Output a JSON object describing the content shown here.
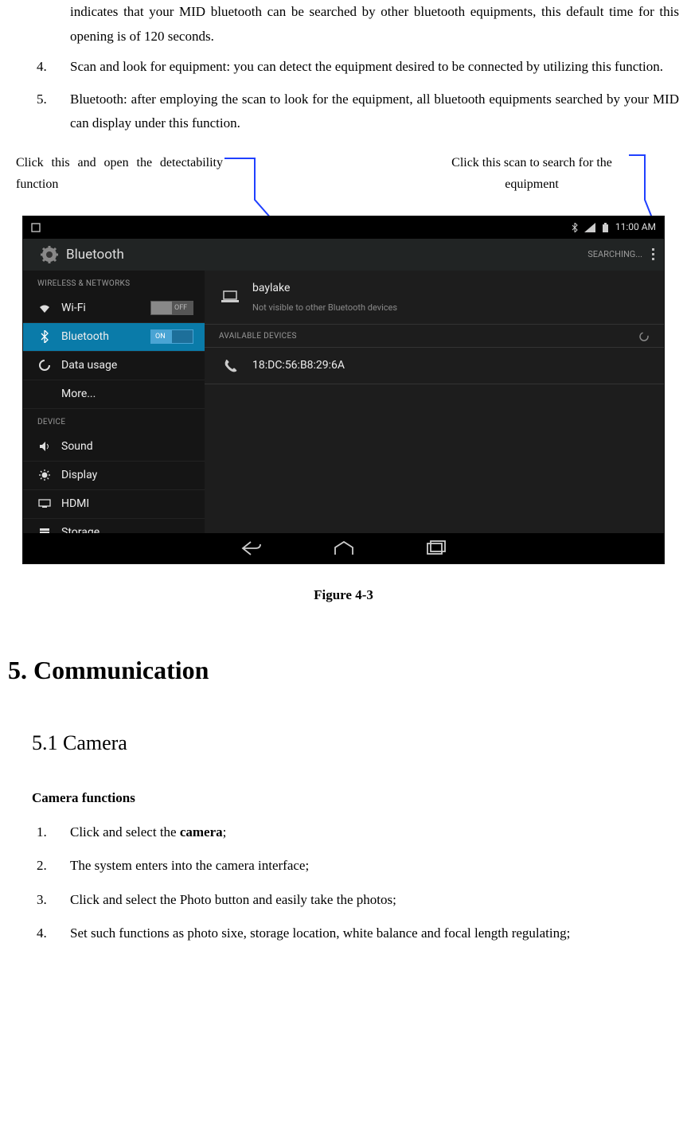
{
  "doc": {
    "continued_text": "indicates that your MID bluetooth can be searched by other bluetooth equipments, this default time for this opening is of 120 seconds.",
    "item4_num": "4.",
    "item4": "Scan and look for equipment: you can detect the equipment desired to be connected by utilizing this function.",
    "item5_num": "5.",
    "item5": "Bluetooth: after employing the scan to look for the equipment, all bluetooth equipments searched by your MID can display under this function.",
    "callout_left": "Click this and open the detectability function",
    "callout_right": "Click this scan to search for the equipment",
    "figure_caption": "Figure 4-3",
    "section5": "5. Communication",
    "subsection51": "5.1 Camera",
    "camera_functions_head": "Camera functions",
    "cam1_num": "1.",
    "cam1_pre": "Click and select the ",
    "cam1_bold": "camera",
    "cam1_post": ";",
    "cam2_num": "2.",
    "cam2": "The system enters into the camera interface;",
    "cam3_num": "3.",
    "cam3": "Click and select the Photo button and easily take the photos;",
    "cam4_num": "4.",
    "cam4": "Set such functions as photo sixe, storage location, white balance and focal length regulating;"
  },
  "screenshot": {
    "status_time": "11:00 AM",
    "app_title": "Bluetooth",
    "searching_label": "SEARCHING...",
    "section_wireless": "WIRELESS & NETWORKS",
    "section_device": "DEVICE",
    "wifi_label": "Wi-Fi",
    "wifi_switch": "OFF",
    "bluetooth_label": "Bluetooth",
    "bluetooth_switch": "ON",
    "data_usage_label": "Data usage",
    "more_label": "More...",
    "sound_label": "Sound",
    "display_label": "Display",
    "hdmi_label": "HDMI",
    "storage_label": "Storage",
    "self_device_name": "baylake",
    "self_device_sub": "Not visible to other Bluetooth devices",
    "available_devices_header": "AVAILABLE DEVICES",
    "found_mac": "18:DC:56:B8:29:6A"
  }
}
